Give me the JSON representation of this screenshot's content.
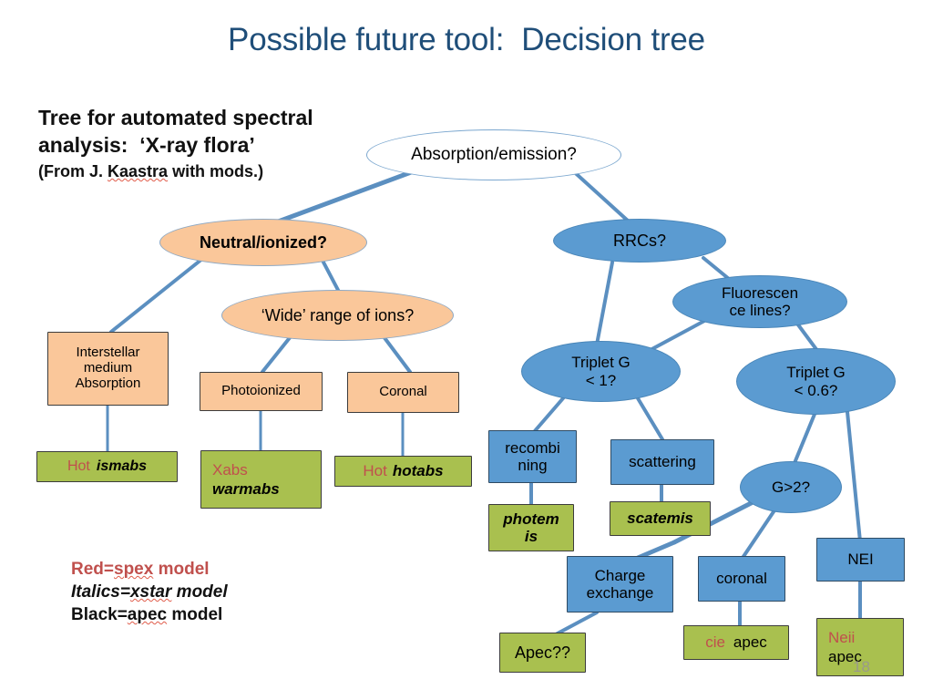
{
  "slide": {
    "title": "Possible future tool:  Decision tree",
    "number": "18",
    "title_color": "#1f4e79"
  },
  "heading": {
    "line1": "Tree for automated spectral",
    "line2": "analysis:  ‘X-ray flora’",
    "line3_a": "(From J. ",
    "line3_b": "Kaastra",
    "line3_c": " with mods.)"
  },
  "palette": {
    "peach": "#fac79a",
    "blue": "#5b9bd1",
    "green": "#a9c04f",
    "connector": "#5b8fc0",
    "red_text": "#c0504d",
    "black_text": "#000000",
    "white": "#ffffff"
  },
  "nodes": {
    "root": {
      "label": "Absorption/emission?",
      "shape": "ellipse",
      "fill": "white"
    },
    "neutral_ionized": {
      "label": "Neutral/ionized?",
      "shape": "ellipse",
      "fill": "peach"
    },
    "wide_range": {
      "label": "‘Wide’ range of ions?",
      "shape": "ellipse",
      "fill": "peach"
    },
    "ism_absorption": {
      "label": "Interstellar\nmedium\nAbsorption",
      "shape": "box",
      "fill": "peach"
    },
    "photoionized": {
      "label": "Photoionized",
      "shape": "box",
      "fill": "peach"
    },
    "coronal_box": {
      "label": "Coronal",
      "shape": "box",
      "fill": "peach"
    },
    "ismabs": {
      "red": "Hot",
      "black": "ismabs",
      "shape": "box",
      "fill": "green"
    },
    "warmabs": {
      "red": "Xabs",
      "black": "warmabs",
      "shape": "box",
      "fill": "green"
    },
    "hotabs": {
      "red": "Hot",
      "black": "hotabs",
      "shape": "box",
      "fill": "green"
    },
    "rrcs": {
      "label": "RRCs?",
      "shape": "ellipse",
      "fill": "blue"
    },
    "fluorescence": {
      "label": "Fluorescen\nce lines?",
      "shape": "ellipse",
      "fill": "blue"
    },
    "triplet_g_1": {
      "label": "Triplet G\n< 1?",
      "shape": "ellipse",
      "fill": "blue"
    },
    "triplet_g_06": {
      "label": "Triplet G\n< 0.6?",
      "shape": "ellipse",
      "fill": "blue"
    },
    "g_gt_2": {
      "label": "G>2?",
      "shape": "ellipse",
      "fill": "blue"
    },
    "recombining": {
      "label": "recombi\nning",
      "shape": "box",
      "fill": "blue"
    },
    "scattering": {
      "label": "scattering",
      "shape": "box",
      "fill": "blue"
    },
    "charge_exchange": {
      "label": "Charge\nexchange",
      "shape": "box",
      "fill": "blue"
    },
    "coronal_blue": {
      "label": "coronal",
      "shape": "box",
      "fill": "blue"
    },
    "nei": {
      "label": "NEI",
      "shape": "box",
      "fill": "blue"
    },
    "photemis": {
      "black": "photem\nis",
      "shape": "box",
      "fill": "green"
    },
    "scatemis": {
      "black": "scatemis",
      "shape": "box",
      "fill": "green"
    },
    "apec_q": {
      "black": "Apec??",
      "shape": "box",
      "fill": "green"
    },
    "cie_apec": {
      "red": "cie",
      "black": "apec",
      "shape": "box",
      "fill": "green"
    },
    "neii_apec": {
      "red": "Neii",
      "black": "apec",
      "shape": "box",
      "fill": "green"
    }
  },
  "legend": {
    "line1_a": "Red=",
    "line1_b": "spex",
    "line1_c": " model",
    "line2_a": "Italics=",
    "line2_b": "xstar",
    "line2_c": " model",
    "line3_a": "Black=",
    "line3_b": "apec",
    "line3_c": " model"
  }
}
